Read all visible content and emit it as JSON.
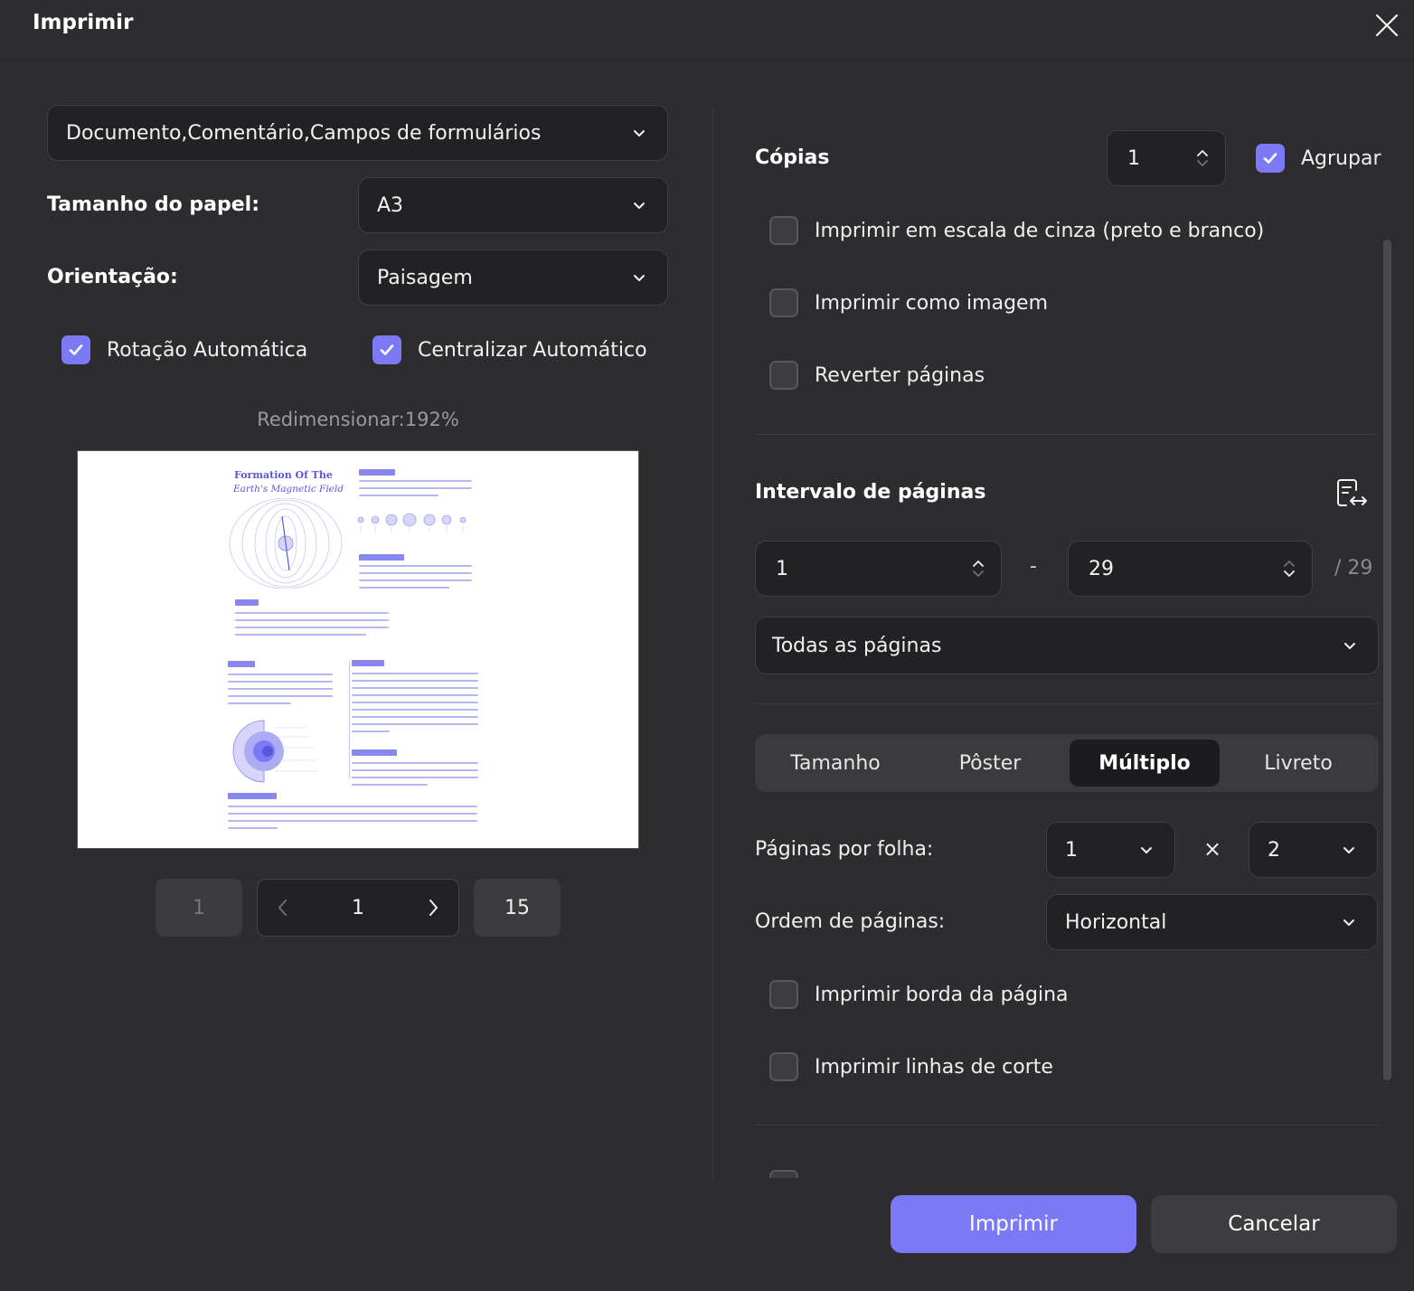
{
  "window": {
    "title": "Imprimir"
  },
  "left": {
    "content_select": "Documento,Comentário,Campos de formulários",
    "paper_size_label": "Tamanho do papel:",
    "paper_size_value": "A3",
    "orientation_label": "Orientação:",
    "orientation_value": "Paisagem",
    "auto_rotate": {
      "label": "Rotação Automática",
      "checked": true
    },
    "auto_center": {
      "label": "Centralizar Automático",
      "checked": true
    },
    "zoom_text": "Redimensionar:192%",
    "preview": {
      "heading_line1": "Formation Of The",
      "heading_line2": "Earth's Magnetic Field"
    },
    "pagination": {
      "first": "1",
      "current": "1",
      "last": "15"
    }
  },
  "right": {
    "copies_label": "Cópias",
    "copies_value": "1",
    "collate": {
      "label": "Agrupar",
      "checked": true
    },
    "options": [
      {
        "label": "Imprimir em escala de cinza (preto e branco)",
        "checked": false
      },
      {
        "label": "Imprimir como imagem",
        "checked": false
      },
      {
        "label": "Reverter páginas",
        "checked": false
      }
    ],
    "range_label": "Intervalo de páginas",
    "range_from": "1",
    "range_dash": "-",
    "range_to": "29",
    "range_total": "/ 29",
    "range_subset": "Todas as páginas",
    "tabs": [
      "Tamanho",
      "Pôster",
      "Múltiplo",
      "Livreto"
    ],
    "active_tab": "Múltiplo",
    "pages_per_sheet_label": "Páginas por folha:",
    "pages_per_sheet_cols": "1",
    "pages_per_sheet_times": "×",
    "pages_per_sheet_rows": "2",
    "page_order_label": "Ordem de páginas:",
    "page_order_value": "Horizontal",
    "print_border": {
      "label": "Imprimir borda da página",
      "checked": false
    },
    "print_cut_lines": {
      "label": "Imprimir linhas de corte",
      "checked": false
    }
  },
  "footer": {
    "print_button": "Imprimir",
    "cancel_button": "Cancelar"
  },
  "colors": {
    "accent": "#7b79f6",
    "background": "#2d2d2f",
    "field": "#222224"
  }
}
